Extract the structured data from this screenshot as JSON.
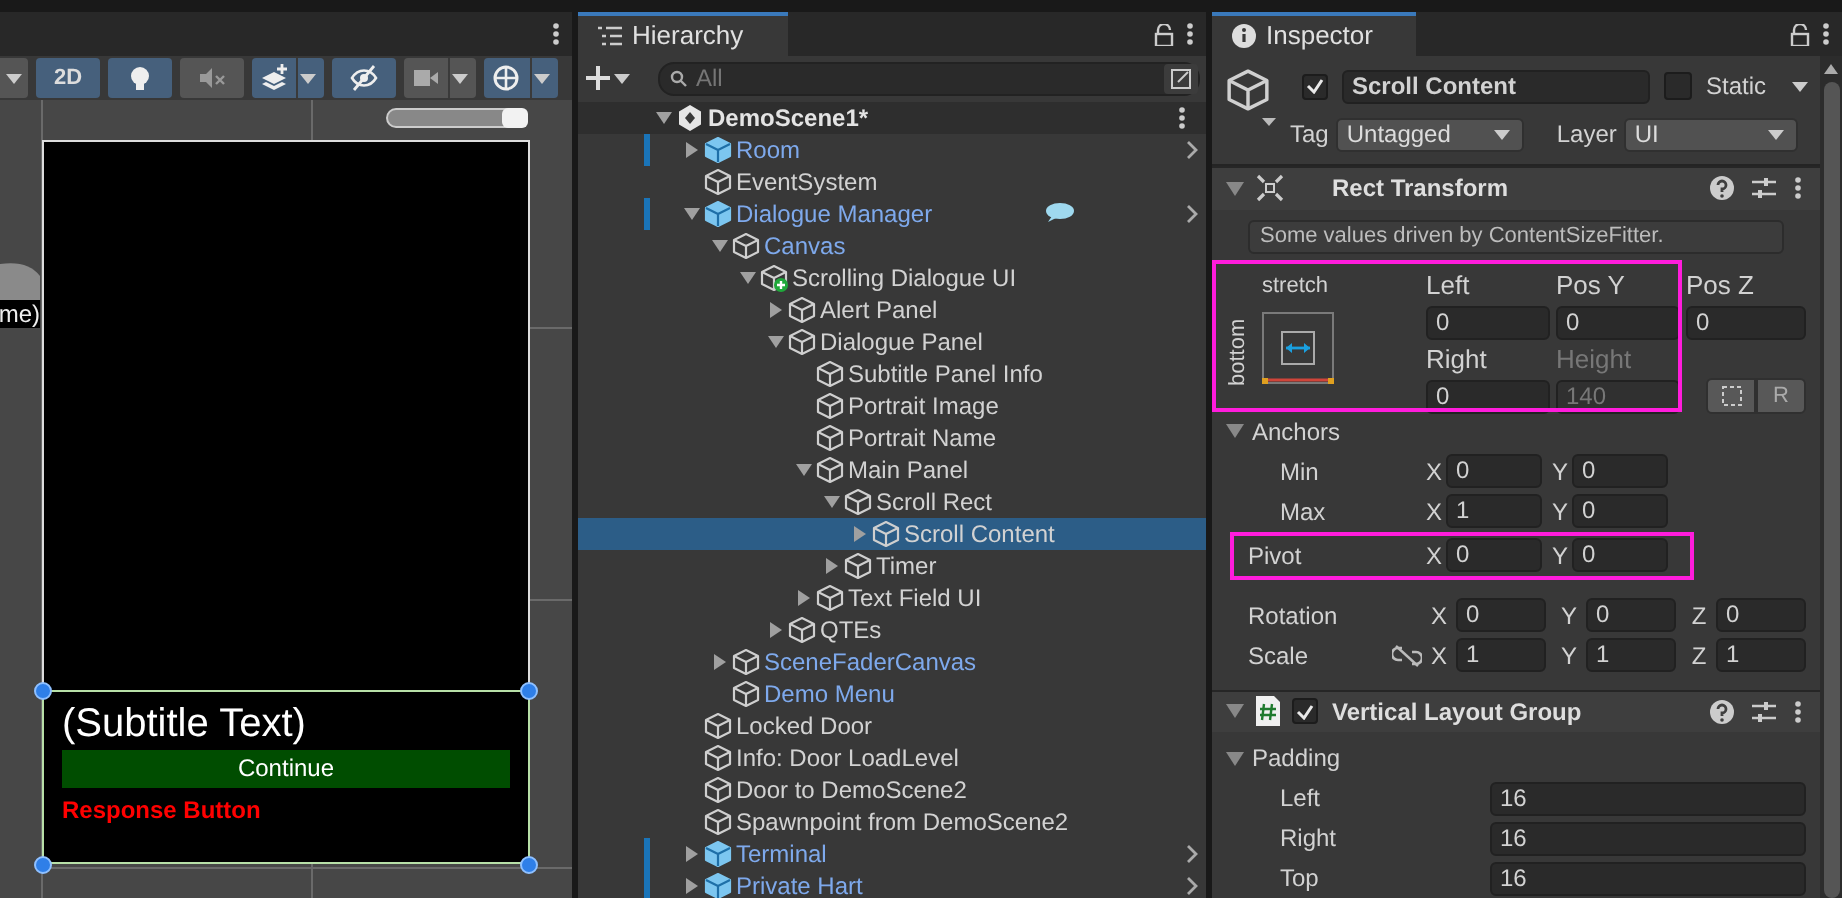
{
  "scene_view": {
    "toolbar": [
      {
        "kind": "dropdown",
        "on": false,
        "dropdown": true
      },
      {
        "kind": "text",
        "label": "2D",
        "on": true,
        "dropdown": false
      },
      {
        "kind": "light",
        "on": true,
        "dropdown": false
      },
      {
        "kind": "audio",
        "on": false,
        "dropdown": false
      },
      {
        "kind": "effects",
        "on": true,
        "dropdown": true
      },
      {
        "kind": "visibility",
        "on": true,
        "dropdown": false
      },
      {
        "kind": "camera",
        "on": false,
        "dropdown": true
      },
      {
        "kind": "gizmos",
        "on": true,
        "dropdown": true
      }
    ],
    "zoom_slider": {
      "level": 1
    },
    "clipped_label": "me)",
    "subtitle_text": "(Subtitle Text)",
    "continue_button": "Continue",
    "response_button": "Response Button"
  },
  "hierarchy": {
    "title": "Hierarchy",
    "search_placeholder": "All",
    "tree": [
      {
        "label": "DemoScene1*",
        "kind": "scene",
        "expanded": true,
        "selected": false,
        "children": [
          {
            "label": "Room",
            "kind": "prefab_root",
            "expanded": false,
            "selected": false
          },
          {
            "label": "EventSystem",
            "kind": "object",
            "selected": false
          },
          {
            "label": "Dialogue Manager",
            "kind": "prefab_root",
            "expanded": true,
            "selected": false,
            "annotation_icon": true,
            "children": [
              {
                "label": "Canvas",
                "kind": "prefab_child",
                "expanded": true,
                "selected": false,
                "children": [
                  {
                    "label": "Scrolling Dialogue UI",
                    "kind": "added_object",
                    "expanded": true,
                    "selected": false,
                    "children": [
                      {
                        "label": "Alert Panel",
                        "kind": "object",
                        "expanded": false,
                        "selected": false
                      },
                      {
                        "label": "Dialogue Panel",
                        "kind": "object",
                        "expanded": true,
                        "selected": false,
                        "children": [
                          {
                            "label": "Subtitle Panel Info",
                            "kind": "object",
                            "selected": false
                          },
                          {
                            "label": "Portrait Image",
                            "kind": "object",
                            "selected": false
                          },
                          {
                            "label": "Portrait Name",
                            "kind": "object",
                            "selected": false
                          },
                          {
                            "label": "Main Panel",
                            "kind": "object",
                            "expanded": true,
                            "selected": false,
                            "children": [
                              {
                                "label": "Scroll Rect",
                                "kind": "object",
                                "expanded": true,
                                "selected": false,
                                "children": [
                                  {
                                    "label": "Scroll Content",
                                    "kind": "object",
                                    "expanded": false,
                                    "selected": true
                                  }
                                ]
                              },
                              {
                                "label": "Timer",
                                "kind": "object",
                                "expanded": false,
                                "selected": false
                              }
                            ]
                          },
                          {
                            "label": "Text Field UI",
                            "kind": "object",
                            "expanded": false,
                            "selected": false
                          }
                        ]
                      },
                      {
                        "label": "QTEs",
                        "kind": "object",
                        "expanded": false,
                        "selected": false
                      }
                    ]
                  }
                ]
              },
              {
                "label": "SceneFaderCanvas",
                "kind": "prefab_child",
                "expanded": false,
                "selected": false
              },
              {
                "label": "Demo Menu",
                "kind": "prefab_child",
                "selected": false
              }
            ]
          },
          {
            "label": "Locked Door",
            "kind": "object",
            "selected": false
          },
          {
            "label": "Info: Door LoadLevel",
            "kind": "object",
            "selected": false
          },
          {
            "label": "Door to DemoScene2",
            "kind": "object",
            "selected": false
          },
          {
            "label": "Spawnpoint from DemoScene2",
            "kind": "object",
            "selected": false
          },
          {
            "label": "Terminal",
            "kind": "prefab_root",
            "expanded": false,
            "selected": false
          },
          {
            "label": "Private Hart",
            "kind": "prefab_root",
            "expanded": false,
            "selected": false
          }
        ]
      }
    ]
  },
  "inspector": {
    "title": "Inspector",
    "object": {
      "active": true,
      "name": "Scroll Content",
      "static": false,
      "static_label": "Static",
      "tag_label": "Tag",
      "tag": "Untagged",
      "layer_label": "Layer",
      "layer": "UI"
    },
    "rect_transform": {
      "title": "Rect Transform",
      "expanded": true,
      "notice": "Some values driven by ContentSizeFitter.",
      "highlighted": true,
      "preset_h": "stretch",
      "preset_v": "bottom",
      "fields": [
        {
          "label": "Left",
          "value": "0",
          "disabled": false
        },
        {
          "label": "Pos Y",
          "value": "0",
          "disabled": false
        },
        {
          "label": "Pos Z",
          "value": "0",
          "disabled": false
        },
        {
          "label": "Right",
          "value": "0",
          "disabled": false
        },
        {
          "label": "Height",
          "value": "140",
          "disabled": true
        }
      ],
      "raw_button": "R",
      "anchors": {
        "label": "Anchors",
        "expanded": true,
        "rows": [
          {
            "label": "Min",
            "components": [
              {
                "axis": "X",
                "value": "0"
              },
              {
                "axis": "Y",
                "value": "0"
              }
            ]
          },
          {
            "label": "Max",
            "components": [
              {
                "axis": "X",
                "value": "1"
              },
              {
                "axis": "Y",
                "value": "0"
              }
            ]
          }
        ]
      },
      "pivot": {
        "label": "Pivot",
        "highlighted": true,
        "components": [
          {
            "axis": "X",
            "value": "0"
          },
          {
            "axis": "Y",
            "value": "0"
          }
        ]
      },
      "rotation": {
        "label": "Rotation",
        "components": [
          {
            "axis": "X",
            "value": "0"
          },
          {
            "axis": "Y",
            "value": "0"
          },
          {
            "axis": "Z",
            "value": "0"
          }
        ]
      },
      "scale": {
        "label": "Scale",
        "components": [
          {
            "axis": "X",
            "value": "1"
          },
          {
            "axis": "Y",
            "value": "1"
          },
          {
            "axis": "Z",
            "value": "1"
          }
        ]
      }
    },
    "vertical_layout_group": {
      "title": "Vertical Layout Group",
      "enabled": true,
      "padding": {
        "label": "Padding",
        "expanded": true,
        "rows": [
          {
            "label": "Left",
            "value": "16"
          },
          {
            "label": "Right",
            "value": "16"
          },
          {
            "label": "Top",
            "value": "16"
          }
        ]
      }
    }
  }
}
